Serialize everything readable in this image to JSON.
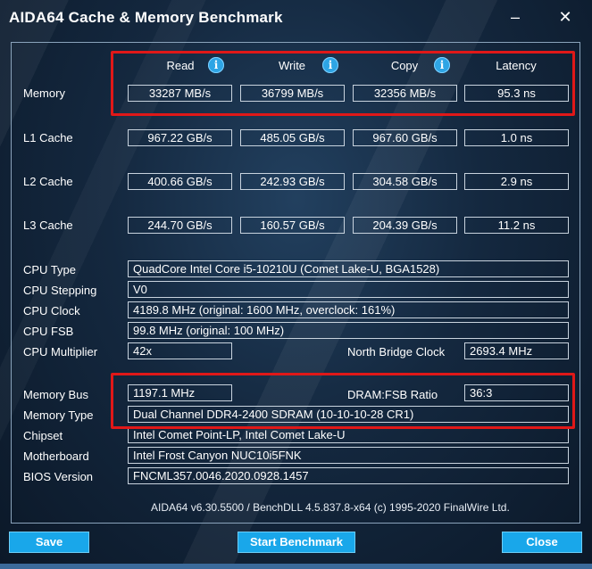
{
  "window": {
    "title": "AIDA64 Cache & Memory Benchmark",
    "minimize_glyph": "–",
    "close_glyph": "✕"
  },
  "columns": {
    "read": "Read",
    "write": "Write",
    "copy": "Copy",
    "latency": "Latency",
    "info_glyph": "i"
  },
  "rows": {
    "memory": {
      "label": "Memory",
      "read": "33287 MB/s",
      "write": "36799 MB/s",
      "copy": "32356 MB/s",
      "latency": "95.3 ns"
    },
    "l1": {
      "label": "L1 Cache",
      "read": "967.22 GB/s",
      "write": "485.05 GB/s",
      "copy": "967.60 GB/s",
      "latency": "1.0 ns"
    },
    "l2": {
      "label": "L2 Cache",
      "read": "400.66 GB/s",
      "write": "242.93 GB/s",
      "copy": "304.58 GB/s",
      "latency": "2.9 ns"
    },
    "l3": {
      "label": "L3 Cache",
      "read": "244.70 GB/s",
      "write": "160.57 GB/s",
      "copy": "204.39 GB/s",
      "latency": "11.2 ns"
    }
  },
  "info": {
    "cpu_type": {
      "label": "CPU Type",
      "value": "QuadCore Intel Core i5-10210U  (Comet Lake-U, BGA1528)"
    },
    "cpu_stepping": {
      "label": "CPU Stepping",
      "value": "V0"
    },
    "cpu_clock": {
      "label": "CPU Clock",
      "value": "4189.8 MHz  (original: 1600 MHz, overclock: 161%)"
    },
    "cpu_fsb": {
      "label": "CPU FSB",
      "value": "99.8 MHz  (original: 100 MHz)"
    },
    "cpu_multiplier": {
      "label": "CPU Multiplier",
      "value": "42x"
    },
    "north_bridge_clock": {
      "label": "North Bridge Clock",
      "value": "2693.4 MHz"
    },
    "memory_bus": {
      "label": "Memory Bus",
      "value": "1197.1 MHz"
    },
    "dram_fsb_ratio": {
      "label": "DRAM:FSB Ratio",
      "value": "36:3"
    },
    "memory_type": {
      "label": "Memory Type",
      "value": "Dual Channel DDR4-2400 SDRAM  (10-10-10-28 CR1)"
    },
    "chipset": {
      "label": "Chipset",
      "value": "Intel Comet Point-LP, Intel Comet Lake-U"
    },
    "motherboard": {
      "label": "Motherboard",
      "value": "Intel Frost Canyon NUC10i5FNK"
    },
    "bios_version": {
      "label": "BIOS Version",
      "value": "FNCML357.0046.2020.0928.1457"
    }
  },
  "footer": "AIDA64 v6.30.5500 / BenchDLL 4.5.837.8-x64  (c) 1995-2020 FinalWire Ltd.",
  "buttons": {
    "save": "Save",
    "start": "Start Benchmark",
    "close": "Close"
  },
  "colors": {
    "accent": "#19a7ea",
    "highlight": "#e01818",
    "panel_border": "#8aa3bb"
  }
}
